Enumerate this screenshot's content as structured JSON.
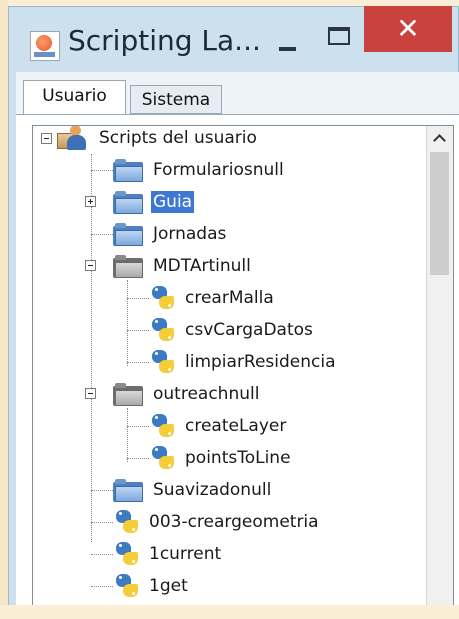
{
  "window": {
    "title": "Scripting La...",
    "buttons": {
      "minimize": "minimize",
      "maximize": "maximize",
      "close_symbol": "✕"
    }
  },
  "tabs": [
    {
      "label": "Usuario",
      "active": true
    },
    {
      "label": "Sistema",
      "active": false
    }
  ],
  "tree": {
    "root": {
      "label": "Scripts del usuario",
      "icon": "user-folder-icon",
      "expanded": true
    },
    "items": [
      {
        "label": "Formulariosnull",
        "icon": "folder-icon",
        "level": 1
      },
      {
        "label": "Guia",
        "icon": "folder-icon",
        "level": 1,
        "expandable": true,
        "selected": true
      },
      {
        "label": "Jornadas",
        "icon": "folder-icon",
        "level": 1
      },
      {
        "label": "MDTArtinull",
        "icon": "folder-open-icon",
        "level": 1,
        "expanded": true
      },
      {
        "label": "crearMalla",
        "icon": "python-icon",
        "level": 2
      },
      {
        "label": "csvCargaDatos",
        "icon": "python-icon",
        "level": 2
      },
      {
        "label": "limpiarResidencia",
        "icon": "python-icon",
        "level": 2
      },
      {
        "label": "outreachnull",
        "icon": "folder-open-icon",
        "level": 1,
        "expanded": true
      },
      {
        "label": "createLayer",
        "icon": "python-icon",
        "level": 2
      },
      {
        "label": "pointsToLine",
        "icon": "python-icon",
        "level": 2
      },
      {
        "label": "Suavizadonull",
        "icon": "folder-icon",
        "level": 1
      },
      {
        "label": "003-creargeometria",
        "icon": "python-icon",
        "level": 1
      },
      {
        "label": "1current",
        "icon": "python-icon",
        "level": 1
      },
      {
        "label": "1get",
        "icon": "python-icon",
        "level": 1
      }
    ]
  },
  "colors": {
    "selection": "#3f78d2",
    "close_button": "#c9423e",
    "window_frame": "#cde0ee"
  }
}
